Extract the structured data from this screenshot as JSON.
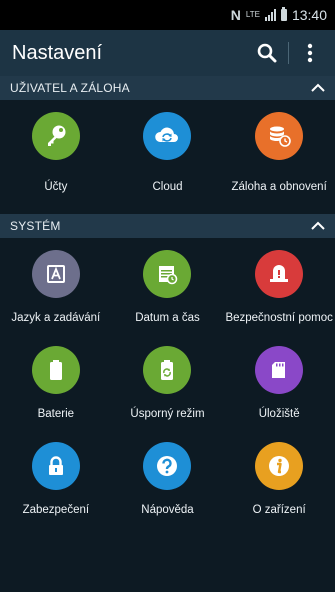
{
  "status_bar": {
    "network": "N",
    "lte": "LTE",
    "time": "13:40"
  },
  "action_bar": {
    "title": "Nastavení",
    "search_icon": "search-icon",
    "more_icon": "more-vertical-icon"
  },
  "sections": [
    {
      "title": "UŽIVATEL A ZÁLOHA",
      "items": [
        {
          "label": "Účty",
          "icon": "key-icon",
          "color": "#6aa934"
        },
        {
          "label": "Cloud",
          "icon": "cloud-sync-icon",
          "color": "#1e8fd6"
        },
        {
          "label": "Záloha a obnovení",
          "icon": "backup-icon",
          "color": "#e8702a"
        }
      ]
    },
    {
      "title": "SYSTÉM",
      "items": [
        {
          "label": "Jazyk a zadávání",
          "icon": "language-icon",
          "color": "#6d6f8c"
        },
        {
          "label": "Datum a čas",
          "icon": "calendar-clock-icon",
          "color": "#6aa934"
        },
        {
          "label": "Bezpečnostní pomoc",
          "icon": "alert-light-icon",
          "color": "#d83b3b"
        },
        {
          "label": "Baterie",
          "icon": "battery-icon",
          "color": "#6aa934"
        },
        {
          "label": "Úsporný režim",
          "icon": "recycle-battery-icon",
          "color": "#6aa934"
        },
        {
          "label": "Úložiště",
          "icon": "sd-card-icon",
          "color": "#8a48c8"
        },
        {
          "label": "Zabezpečení",
          "icon": "lock-icon",
          "color": "#1e8fd6"
        },
        {
          "label": "Nápověda",
          "icon": "help-icon",
          "color": "#1e8fd6"
        },
        {
          "label": "O zařízení",
          "icon": "info-icon",
          "color": "#e8a020"
        }
      ]
    }
  ]
}
